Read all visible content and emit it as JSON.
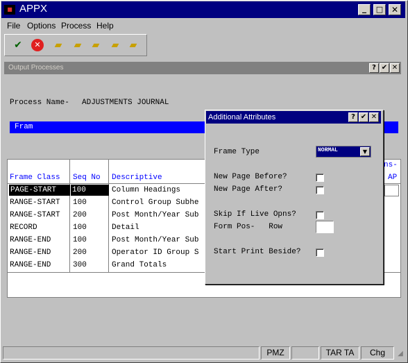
{
  "window": {
    "title": "APPX",
    "logo_text": "APPX"
  },
  "menu": [
    "File",
    "Options",
    "Process",
    "Help"
  ],
  "toolbar_icons": [
    "check-icon",
    "cancel-icon",
    "new-folder-icon",
    "open-folder-icon",
    "find-folder-icon",
    "delete-folder-icon",
    "edit-folder-icon"
  ],
  "panel": {
    "title": "Output Processes",
    "process_label": "Process Name-",
    "process_value": "ADJUSTMENTS JOURNAL",
    "frame_bar_text": "Fram"
  },
  "table": {
    "headers": [
      "Frame Class",
      "Seq No",
      "Descriptive"
    ],
    "right_header_top": "ns-",
    "right_header_bottom": "AP",
    "rows": [
      [
        "PAGE-START",
        "100",
        "Column Headings"
      ],
      [
        "RANGE-START",
        "100",
        "Control Group Subhe"
      ],
      [
        "RANGE-START",
        "200",
        "Post Month/Year Sub"
      ],
      [
        "RECORD",
        "100",
        "Detail"
      ],
      [
        "RANGE-END",
        "100",
        "Post Month/Year Sub"
      ],
      [
        "RANGE-END",
        "200",
        "Operator ID Group S"
      ],
      [
        "RANGE-END",
        "300",
        "Grand Totals"
      ]
    ]
  },
  "dialog": {
    "title": "Additional Attributes",
    "frame_type_label": "Frame Type",
    "frame_type_value": "NORMAL",
    "new_page_before": "New Page Before?",
    "new_page_after": "New Page After?",
    "skip_if_live": "Skip If Live Opns?",
    "form_pos": "Form Pos-   Row",
    "start_print_beside": "Start Print Beside?"
  },
  "statusbar": [
    "PMZ",
    "TAR TA",
    "Chg"
  ],
  "colors": {
    "title_bg": "#000080",
    "frame_bar": "#0000ff",
    "header_text": "#0000ff",
    "delete_icon": "#e02020"
  }
}
